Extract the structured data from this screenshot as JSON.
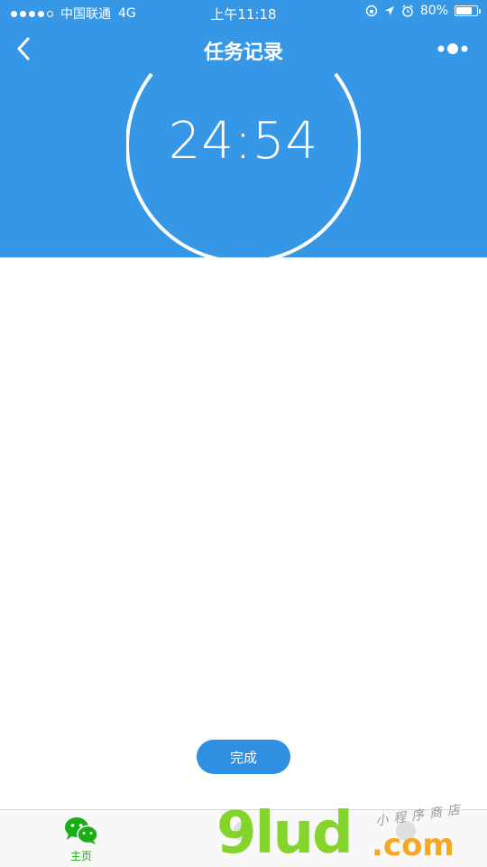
{
  "status_bar": {
    "carrier": "中国联通",
    "network": "4G",
    "time": "上午11:18",
    "battery": "80%",
    "battery_level": 0.8
  },
  "nav": {
    "title": "任务记录",
    "back_icon": "chevron-left-icon",
    "more_icon": "more-dots-icon"
  },
  "timer": {
    "display": "24:54"
  },
  "actions": {
    "done_label": "完成"
  },
  "tab_bar": {
    "items": [
      {
        "label": "主页",
        "icon": "wechat-icon",
        "active": true,
        "color": "#1aad19"
      },
      {
        "label": "",
        "icon": "faded-icon"
      },
      {
        "label": "",
        "icon": "faded-icon"
      }
    ]
  },
  "watermark": {
    "logo": "9lud",
    "sub": "小程序商店",
    "suffix": ".com"
  },
  "colors": {
    "primary": "#3597e6",
    "button": "#2f8fe3",
    "tab_active": "#1aad19"
  }
}
